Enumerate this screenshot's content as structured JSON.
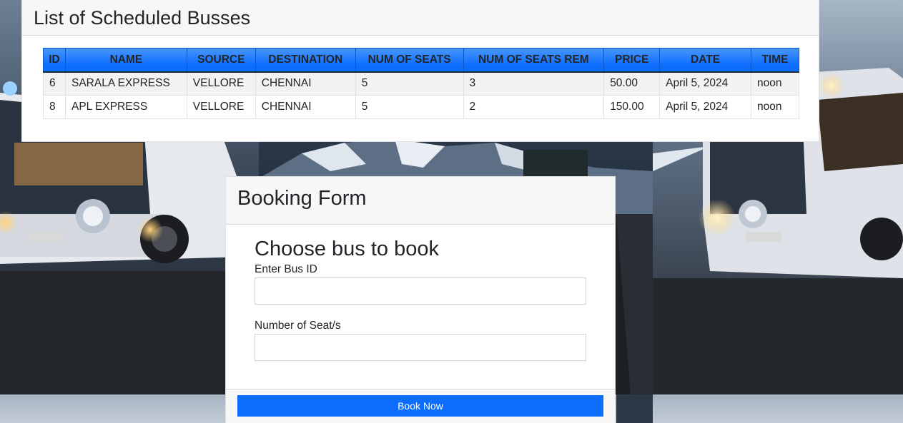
{
  "scheduled": {
    "title": "List of Scheduled Busses",
    "columns": [
      "ID",
      "NAME",
      "SOURCE",
      "DESTINATION",
      "NUM OF SEATS",
      "NUM OF SEATS REM",
      "PRICE",
      "DATE",
      "TIME"
    ],
    "rows": [
      [
        "6",
        "SARALA EXPRESS",
        "VELLORE",
        "CHENNAI",
        "5",
        "3",
        "50.00",
        "April 5, 2024",
        "noon"
      ],
      [
        "8",
        "APL EXPRESS",
        "VELLORE",
        "CHENNAI",
        "5",
        "2",
        "150.00",
        "April 5, 2024",
        "noon"
      ]
    ]
  },
  "booking": {
    "title": "Booking Form",
    "subtitle": "Choose bus to book",
    "bus_id_label": "Enter Bus ID",
    "bus_id_value": "",
    "seats_label": "Number of Seat/s",
    "seats_value": "",
    "submit_label": "Book Now"
  },
  "colors": {
    "accent": "#0d6efd",
    "header_bg": "#f7f7f7"
  }
}
